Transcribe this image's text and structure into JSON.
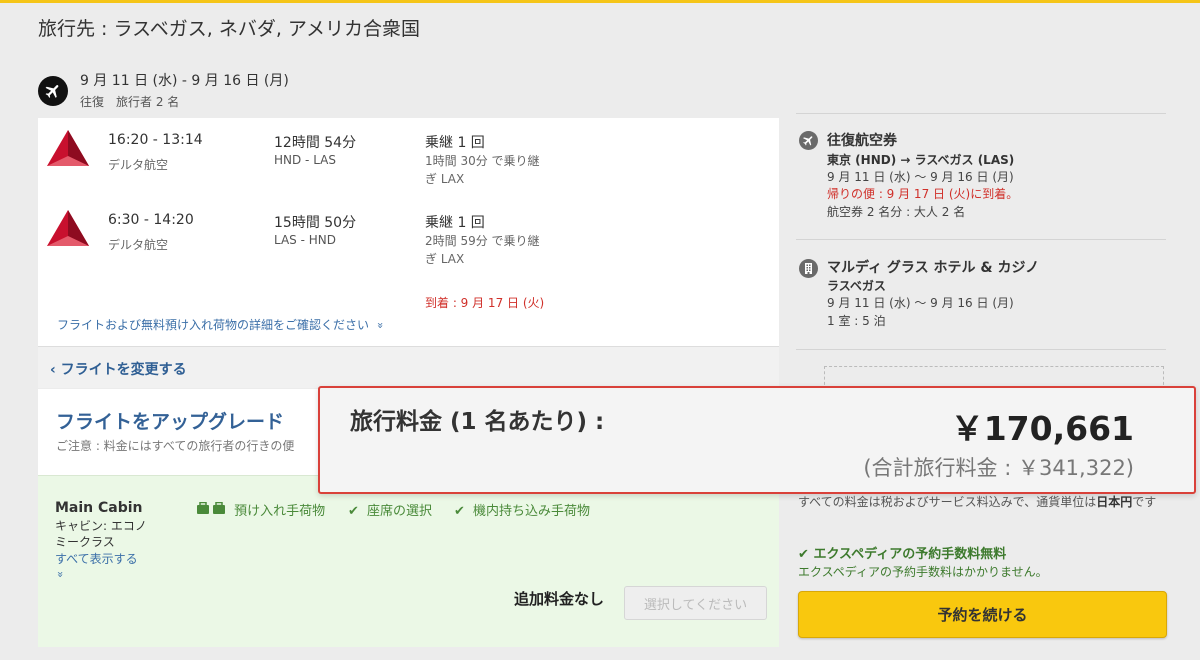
{
  "header": {
    "destination_title": "旅行先 : ラスベガス, ネバダ, アメリカ合衆国",
    "dates": "9 月 11 日 (水) - 9 月 16 日 (月)",
    "trip_meta": "往復　旅行者 2 名"
  },
  "flights": {
    "legs": [
      {
        "times": "16:20 - 13:14",
        "airline": "デルタ航空",
        "duration": "12時間 54分",
        "route": "HND - LAS",
        "stops": "乗継 1 回",
        "layover": "1時間 30分 で乗り継ぎ LAX",
        "arrival_note": ""
      },
      {
        "times": "6:30 - 14:20",
        "airline": "デルタ航空",
        "duration": "15時間 50分",
        "route": "LAS - HND",
        "stops": "乗継 1 回",
        "layover": "2時間 59分 で乗り継ぎ LAX",
        "arrival_note": "到着 : 9 月 17 日 (火)"
      }
    ],
    "details_link": "フライトおよび無料預け入れ荷物の詳細をご確認ください",
    "details_chevron": "»",
    "change_link": "‹ フライトを変更する"
  },
  "upgrade": {
    "title": "フライトをアップグレード",
    "note": "ご注意 : 料金にはすべての旅行者の行きの便"
  },
  "cabin": {
    "name": "Main Cabin",
    "class_text": "キャビン: エコノミークラス",
    "show_all": "すべて表示する",
    "chevron": "»",
    "amenities": [
      "預け入れ手荷物",
      "座席の選択",
      "機内持ち込み手荷物"
    ],
    "no_extra_fee": "追加料金なし",
    "select_button": "選択してください"
  },
  "summary": {
    "flight_title": "往復航空券",
    "flight_route": "東京 (HND) → ラスベガス (LAS)",
    "flight_dates": "9 月 11 日 (水) 〜 9 月 16 日 (月)",
    "flight_return_note": "帰りの便 : 9 月 17 日 (火)に到着。",
    "flight_pax": "航空券 2 名分 : 大人 2 名",
    "hotel_title": "マルディ グラス ホテル & カジノ",
    "hotel_city": "ラスベガス",
    "hotel_dates": "9 月 11 日 (水) 〜 9 月 16 日 (月)",
    "hotel_rooms": "1 室 : 5 泊"
  },
  "price": {
    "label": "旅行料金 (1 名あたり) :",
    "per_person": "￥170,661",
    "total": "(合計旅行料金 : ￥341,322)"
  },
  "notes": {
    "tax_note_pre": "すべての料金は税およびサービス料込みで、通貨単位は",
    "tax_note_bold": "日本円",
    "tax_note_post": "です",
    "fee_free": "エクスペディアの予約手数料無料",
    "fee_free_sub": "エクスペディアの予約手数料はかかりません。"
  },
  "actions": {
    "continue_button": "予約を続ける"
  },
  "colors": {
    "accent_yellow": "#f9c80e",
    "link_blue": "#3b6fa8",
    "alert_red": "#d0302a",
    "success_green": "#3d7a2d",
    "delta_red": "#c8102e"
  },
  "icons": {
    "trip": "airplane-icon",
    "airline": "delta-logo-icon",
    "hotel": "hotel-building-icon",
    "amenity_bag": "luggage-icon",
    "amenity_check": "check-icon"
  }
}
